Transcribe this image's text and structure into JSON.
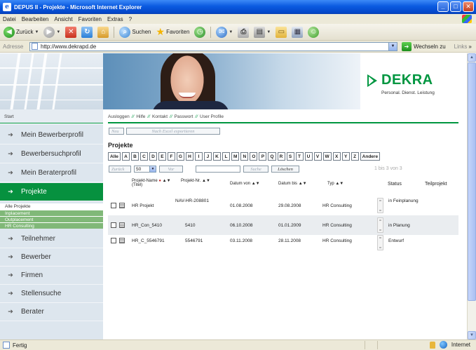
{
  "window": {
    "title": "DEPUS II - Projekte - Microsoft Internet Explorer",
    "logo": "e",
    "min": "_",
    "max": "□",
    "close": "✕"
  },
  "menu": [
    "Datei",
    "Bearbeiten",
    "Ansicht",
    "Favoriten",
    "Extras",
    "?"
  ],
  "toolbar": {
    "back": "Zurück",
    "search": "Suchen",
    "favorites": "Favoriten"
  },
  "address": {
    "label": "Adresse",
    "url": "http://www.dekrapd.de",
    "go": "Wechseln zu",
    "links": "Links"
  },
  "brand": {
    "name": "DEKRA",
    "tagline": "Personal. Dienst. Leistung",
    "color": "#009640"
  },
  "subnav": {
    "start": "Start",
    "links": [
      "Ausloggen",
      "Hilfe",
      "Kontakt",
      "Passwort",
      "User Profile"
    ],
    "separator": "//"
  },
  "sidebar": {
    "items": [
      {
        "label": "Mein Bewerberprofil",
        "arrow": "➔"
      },
      {
        "label": "Bewerbersuchprofil",
        "arrow": "➔"
      },
      {
        "label": "Mein Beraterprofil",
        "arrow": "➔"
      },
      {
        "label": "Projekte",
        "arrow": "➔",
        "active": true
      },
      {
        "label": "Teilnehmer",
        "arrow": "➔"
      },
      {
        "label": "Bewerber",
        "arrow": "➔"
      },
      {
        "label": "Firmen",
        "arrow": "➔"
      },
      {
        "label": "Stellensuche",
        "arrow": "➔"
      },
      {
        "label": "Berater",
        "arrow": "➔"
      }
    ],
    "subitems": [
      "Alle Projekte",
      "Inplacement",
      "Outplacement",
      "HR Consulting"
    ]
  },
  "main": {
    "new_button": "Neu",
    "export_button": "Nach Excel exportieren",
    "heading": "Projekte",
    "letters": [
      "Alle",
      "A",
      "B",
      "C",
      "D",
      "E",
      "F",
      "G",
      "H",
      "I",
      "J",
      "K",
      "L",
      "M",
      "N",
      "O",
      "P",
      "Q",
      "R",
      "S",
      "T",
      "U",
      "V",
      "W",
      "X",
      "Y",
      "Z",
      "Andere"
    ],
    "back_button": "Zurück",
    "page_size": "50",
    "forward_button": "Vor",
    "search_value": "",
    "search_button": "Suche",
    "delete_button": "Löschen",
    "pager": "1 bis 3 von 3",
    "sort_arrows": "▲▼",
    "columns": {
      "name": "Projekt-Name",
      "name_sub": "(Titel)",
      "nr": "Projekt-Nr.",
      "from": "Datum von",
      "to": "Datum bis",
      "type": "Typ",
      "status": "Status",
      "sub": "Teilprojekt"
    },
    "rows": [
      {
        "name": "HR Projekt",
        "nr": "NAV-HR-208801",
        "from": "01.08.2008",
        "to": "29.08.2008",
        "type": "HR Consulting",
        "status": "in Feinplanung",
        "sub": ""
      },
      {
        "name": "HR_Con_5410",
        "nr": "5410",
        "from": "06.10.2008",
        "to": "01.01.2009",
        "type": "HR Consulting",
        "status": "in Planung",
        "sub": ""
      },
      {
        "name": "HR_C_5546791",
        "nr": "5546791",
        "from": "03.11.2008",
        "to": "28.11.2008",
        "type": "HR Consulting",
        "status": "Entwurf",
        "sub": ""
      }
    ]
  },
  "status": {
    "left": "Fertig",
    "zone": "Internet"
  }
}
